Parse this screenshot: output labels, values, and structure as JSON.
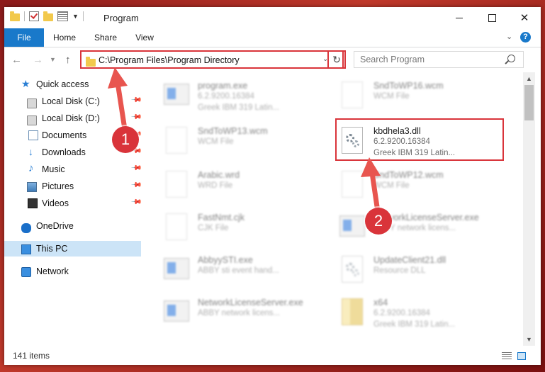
{
  "window": {
    "title": "Program",
    "controls": {
      "minimize": "",
      "maximize": "",
      "close": "✕"
    }
  },
  "ribbon": {
    "tabs": [
      "File",
      "Home",
      "Share",
      "View"
    ],
    "help": "?"
  },
  "nav": {
    "address": "C:\\Program Files\\Program Directory",
    "search_placeholder": "Search Program"
  },
  "sidebar": {
    "items": [
      {
        "label": "Quick access",
        "icon": "star-icon"
      },
      {
        "label": "Local Disk (C:)",
        "icon": "disk-icon",
        "pinned": true
      },
      {
        "label": "Local Disk (D:)",
        "icon": "disk-icon",
        "pinned": true
      },
      {
        "label": "Documents",
        "icon": "documents-icon",
        "pinned": true
      },
      {
        "label": "Downloads",
        "icon": "download-icon",
        "pinned": true
      },
      {
        "label": "Music",
        "icon": "music-icon",
        "pinned": true
      },
      {
        "label": "Pictures",
        "icon": "pictures-icon",
        "pinned": true
      },
      {
        "label": "Videos",
        "icon": "videos-icon",
        "pinned": true
      },
      {
        "label": "OneDrive",
        "icon": "onedrive-icon"
      },
      {
        "label": "This PC",
        "icon": "this-pc-icon",
        "selected": true
      },
      {
        "label": "Network",
        "icon": "network-icon"
      }
    ]
  },
  "files": [
    {
      "name": "program.exe",
      "line2": "6.2.9200.16384",
      "line3": "Greek IBM 319 Latin...",
      "icon": "exe-icon",
      "blurred": true
    },
    {
      "name": "SndToWP16.wcm",
      "line2": "WCM File",
      "line3": "",
      "icon": "page-icon",
      "blurred": true
    },
    {
      "name": "SndToWP13.wcm",
      "line2": "WCM File",
      "line3": "",
      "icon": "page-icon",
      "blurred": true
    },
    {
      "name": "kbdhela3.dll",
      "line2": "6.2.9200.16384",
      "line3": "Greek IBM 319 Latin...",
      "icon": "dll-gear-icon",
      "blurred": false
    },
    {
      "name": "Arabic.wrd",
      "line2": "WRD File",
      "line3": "",
      "icon": "page-icon",
      "blurred": true
    },
    {
      "name": "SndToWP12.wcm",
      "line2": "WCM File",
      "line3": "",
      "icon": "page-icon",
      "blurred": true
    },
    {
      "name": "FastNmt.cjk",
      "line2": "CJK File",
      "line3": "",
      "icon": "page-icon",
      "blurred": true
    },
    {
      "name": "NetworkLicenseServer.exe",
      "line2": "ABBY network licens...",
      "line3": "",
      "icon": "exe-icon",
      "blurred": true
    },
    {
      "name": "AbbyySTI.exe",
      "line2": "ABBY sti event hand...",
      "line3": "",
      "icon": "exe-icon",
      "blurred": true
    },
    {
      "name": "UpdateClient21.dll",
      "line2": "Resource DLL",
      "line3": "",
      "icon": "dll-gear-icon",
      "blurred": true
    },
    {
      "name": "NetworkLicenseServer.exe",
      "line2": "ABBY network licens...",
      "line3": "",
      "icon": "exe-icon",
      "blurred": true
    },
    {
      "name": "x64",
      "line2": "6.2.9200.16384",
      "line3": "Greek IBM 319 Latin...",
      "icon": "zip-icon",
      "blurred": true
    }
  ],
  "status": {
    "count": "141 items"
  },
  "annotations": {
    "step1": "1",
    "step2": "2"
  },
  "colors": {
    "accent": "#1979ca",
    "highlight": "#d9343a"
  }
}
